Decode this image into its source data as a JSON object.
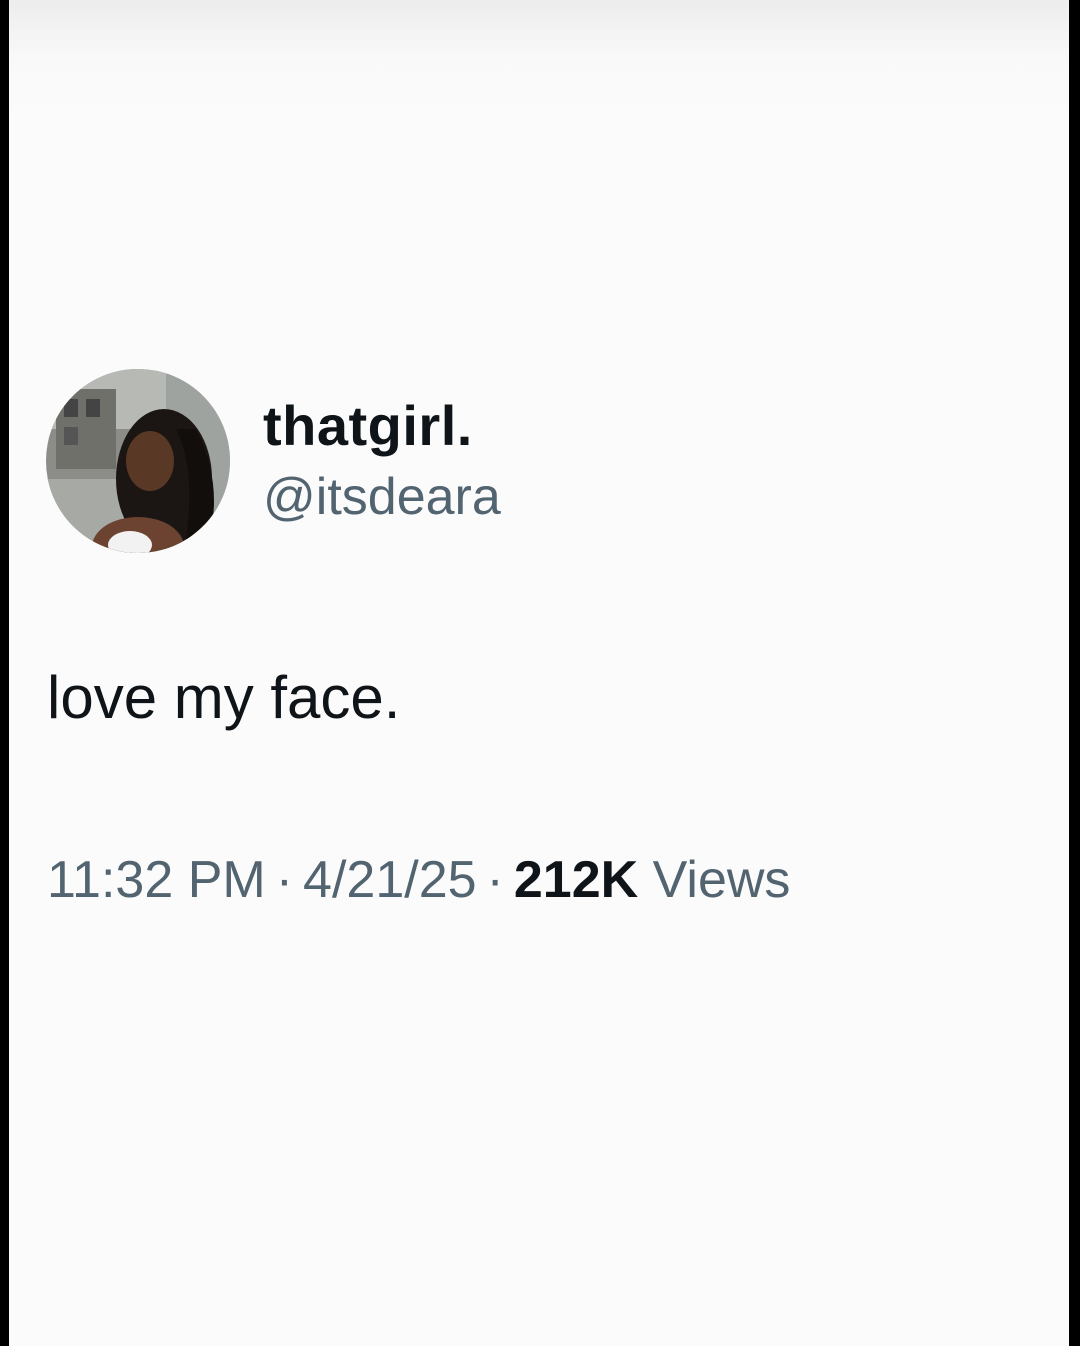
{
  "tweet": {
    "display_name": "thatgirl.",
    "handle": "@itsdeara",
    "text": "love my face.",
    "time": "11:32 PM",
    "date": "4/21/25",
    "separator": "·",
    "views_count": "212K",
    "views_label": "Views"
  },
  "colors": {
    "text_primary": "#0f1419",
    "text_secondary": "#536471",
    "background": "#fbfbfb"
  }
}
